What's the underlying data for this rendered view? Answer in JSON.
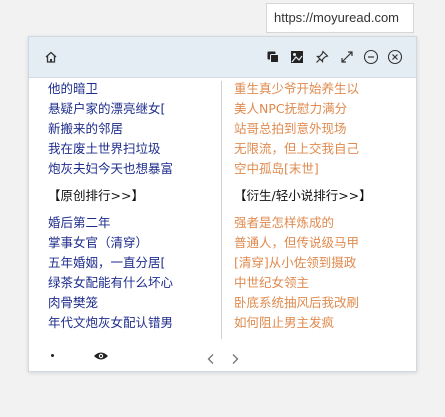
{
  "browser": {
    "url": "https://moyuread.com"
  },
  "left": {
    "top_items": [
      "他的暗卫",
      "悬疑户家的漂亮继女[",
      "新搬来的邻居",
      "我在废土世界扫垃圾",
      "炮灰夫妇今天也想暴富"
    ],
    "rank_link": "【原创排行>>】",
    "bottom_items": [
      "婚后第二年",
      "掌事女官（清穿）",
      "五年婚姻，一直分居[",
      "绿茶女配能有什么坏心",
      "肉骨樊笼",
      "年代文炮灰女配认错男"
    ]
  },
  "right": {
    "top_items": [
      "重生真少爷开始养生以",
      "美人NPC抚慰力满分",
      "站哥总拍到意外现场",
      "无限流，但上交我自己",
      "空中孤岛[末世]"
    ],
    "rank_link": "【衍生/轻小说排行>>】",
    "bottom_items": [
      "强者是怎样炼成的",
      "普通人，但传说级马甲",
      "[清穿]从小佐领到摄政",
      "中世纪女领主",
      "卧底系统抽风后我改刷",
      "如何阻止男主发疯"
    ]
  },
  "icons": {
    "home": "home-icon",
    "copy": "copy-icon",
    "image": "image-icon",
    "pin": "pin-icon",
    "expand": "expand-icon",
    "minimize": "minimize-icon",
    "close": "close-icon",
    "eye": "eye-icon",
    "prev": "chevron-left-icon",
    "next": "chevron-right-icon"
  },
  "colors": {
    "left_text": "#1e2d8c",
    "right_text": "#e08a4e",
    "titlebar_bg": "#e4ecf4"
  }
}
